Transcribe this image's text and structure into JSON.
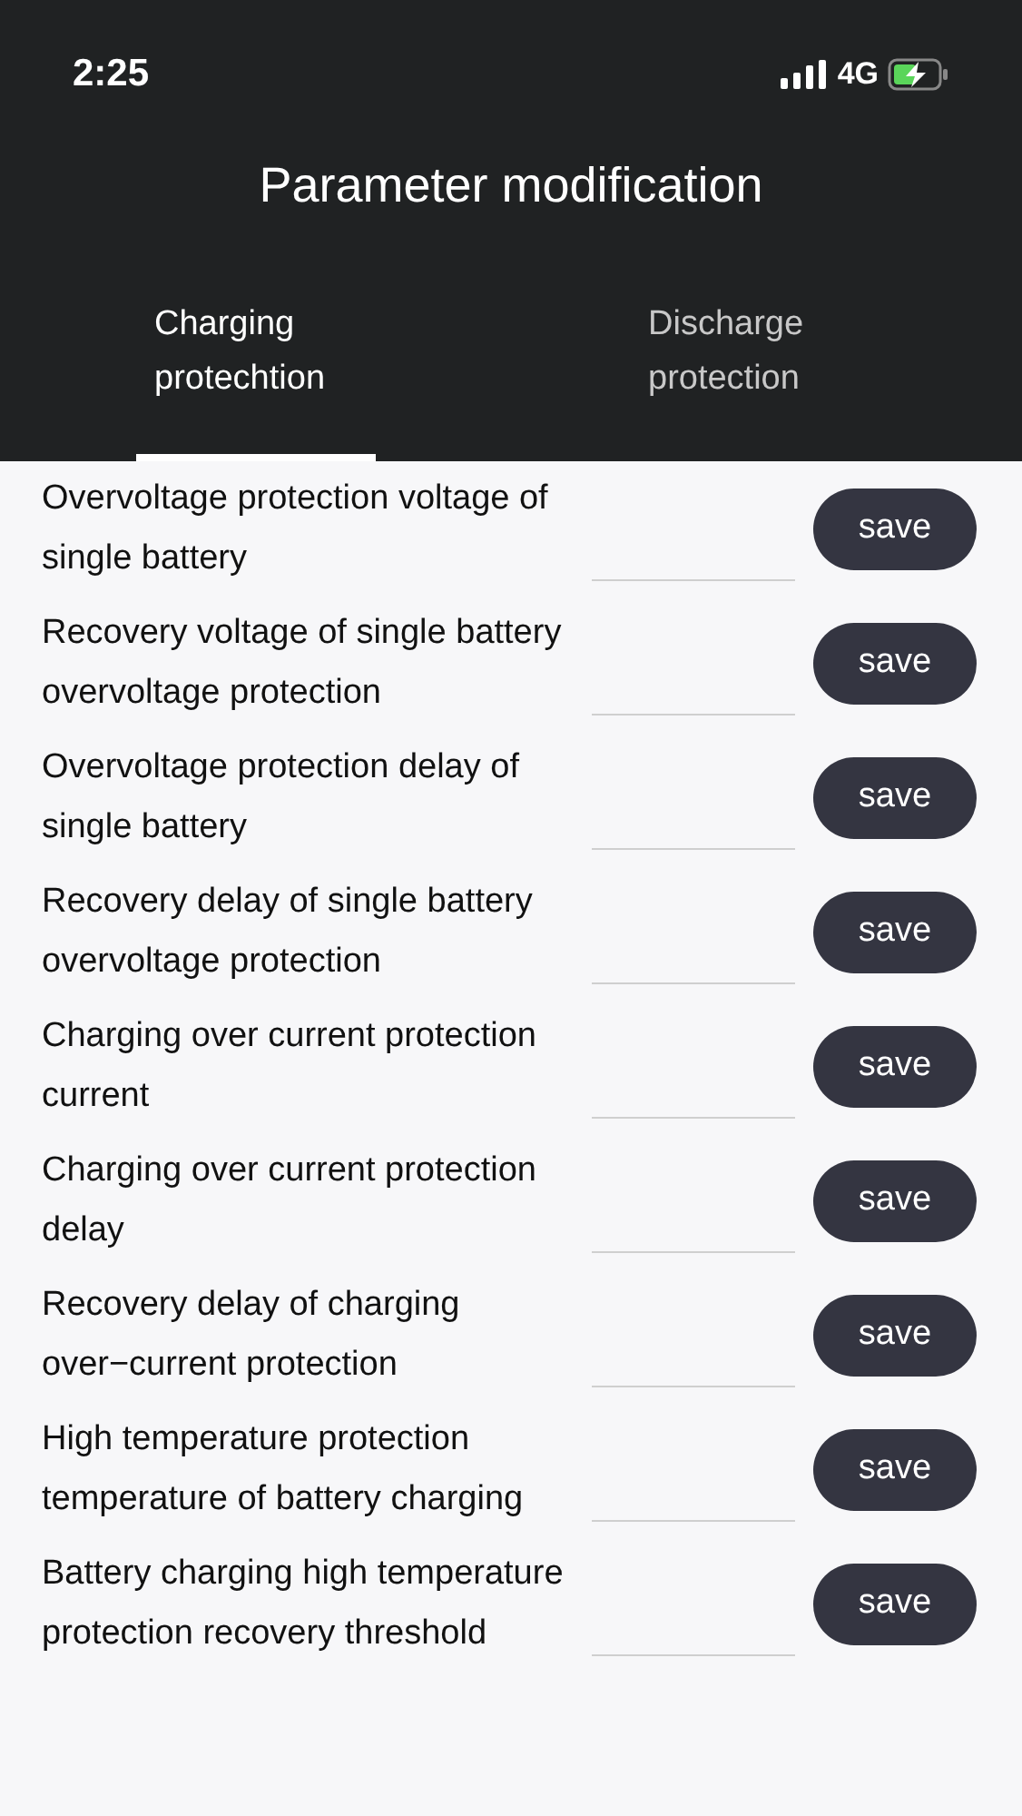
{
  "status_bar": {
    "time": "2:25",
    "network": "4G",
    "charging": true
  },
  "header": {
    "title": "Parameter modification"
  },
  "tabs": [
    {
      "label": "Charging protechtion",
      "selected": true
    },
    {
      "label": "Discharge protection",
      "selected": false
    }
  ],
  "rows": [
    {
      "label": "Overvoltage protection voltage of single battery",
      "button": "save"
    },
    {
      "label": "Recovery voltage of single battery overvoltage protection",
      "button": "save"
    },
    {
      "label": "Overvoltage protection delay of single battery",
      "button": "save"
    },
    {
      "label": "Recovery delay of single battery overvoltage protection",
      "button": "save"
    },
    {
      "label": "Charging over current protection current",
      "button": "save"
    },
    {
      "label": "Charging over current protection delay",
      "button": "save"
    },
    {
      "label": "Recovery delay of charging over−current protection",
      "button": "save"
    },
    {
      "label": "High temperature protection temperature of battery charging",
      "button": "save"
    },
    {
      "label": "Battery charging high temperature protection recovery threshold",
      "button": "save"
    }
  ]
}
